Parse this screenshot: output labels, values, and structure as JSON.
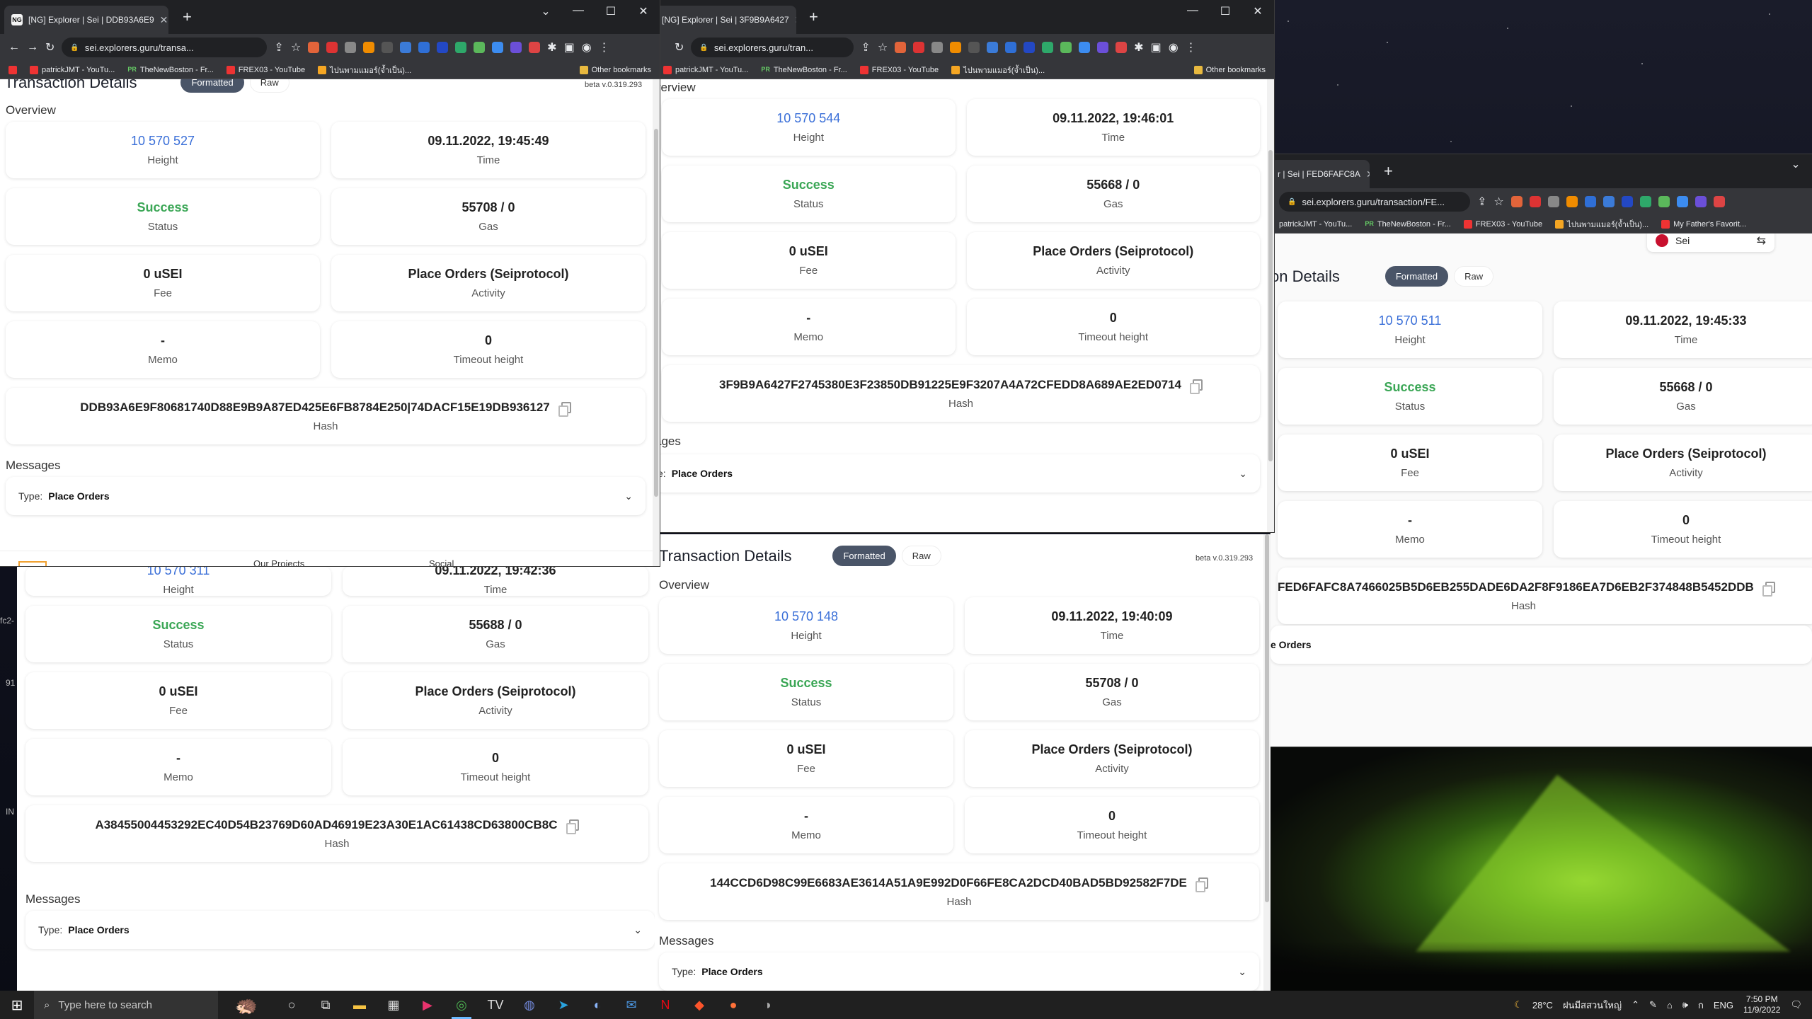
{
  "desktop": {
    "side_fragments": [
      "fc2-",
      "91",
      "IN"
    ]
  },
  "labels": {
    "height": "Height",
    "time": "Time",
    "status": "Status",
    "gas": "Gas",
    "fee": "Fee",
    "activity": "Activity",
    "memo": "Memo",
    "timeout": "Timeout height",
    "hash": "Hash",
    "overview": "Overview",
    "messages": "Messages",
    "type_prefix": "Type:",
    "formatted": "Formatted",
    "raw": "Raw",
    "page_title": "Transaction Details",
    "beta": "beta v.0.319.293",
    "new_tab": "+"
  },
  "win1": {
    "tab_title": "[NG] Explorer | Sei | DDB93A6E9",
    "url": "sei.explorers.guru/transa...",
    "bookmarks": [
      "patrickJMT - YouTu...",
      "TheNewBoston - Fr...",
      "FREX03 - YouTube",
      "ไปนพามแมอร์(จ้ำเป็น)...",
      "Other bookmarks"
    ],
    "height": "10 570 527",
    "time": "09.11.2022, 19:45:49",
    "status": "Success",
    "gas": "55708 / 0",
    "fee": "0 uSEI",
    "activity": "Place Orders (Seiprotocol)",
    "memo": "-",
    "timeout": "0",
    "hash": "DDB93A6E9F80681740D88E9B9A87ED425E6FB8784E250|74DACF15E19DB936127",
    "message_type": "Place Orders",
    "footer_frag": [
      "Our Projects",
      "Social"
    ]
  },
  "win2": {
    "tab_title": "[NG] Explorer | Sei | 3F9B9A6427",
    "url": "sei.explorers.guru/tran...",
    "bookmarks": [
      "patrickJMT - YouTu...",
      "TheNewBoston - Fr...",
      "FREX03 - YouTube",
      "ไปนพามแมอร์(จ้ำเป็น)...",
      "Other bookmarks"
    ],
    "overview_frag": "verview",
    "messages_frag": "ages",
    "type_frag": "e:",
    "height": "10 570 544",
    "time": "09.11.2022, 19:46:01",
    "status": "Success",
    "gas": "55668 / 0",
    "fee": "0 uSEI",
    "activity": "Place Orders (Seiprotocol)",
    "memo": "-",
    "timeout": "0",
    "hash": "3F9B9A6427F2745380E3F23850DB91225E9F3207A4A72CFEDD8A689AE2ED0714",
    "message_type": "Place Orders"
  },
  "win3": {
    "tab_title": "r | Sei | FED6FAFC8A",
    "url": "sei.explorers.guru/transaction/FE...",
    "bookmarks": [
      "patrickJMT - YouTu...",
      "TheNewBoston - Fr...",
      "FREX03 - YouTube",
      "ไปนพามแมอร์(จ้ำเป็น)...",
      "My Father's Favorit..."
    ],
    "chain": "Sei",
    "title_frag": "on Details",
    "height": "10 570 511",
    "time": "09.11.2022, 19:45:33",
    "status": "Success",
    "gas": "55668 / 0",
    "fee": "0 uSEI",
    "activity": "Place Orders (Seiprotocol)",
    "memo": "-",
    "timeout": "0",
    "hash": "FED6FAFC8A7466025B5D6EB255DADE6DA2F8F9186EA7D6EB2F374848B5452DDB",
    "message_frag": "e Orders"
  },
  "win4": {
    "height": "10 570 311",
    "time": "09.11.2022, 19:42:36",
    "status": "Success",
    "gas": "55688 / 0",
    "fee": "0 uSEI",
    "activity": "Place Orders (Seiprotocol)",
    "memo": "-",
    "timeout": "0",
    "hash": "A38455004453292EC40D54B23769D60AD46919E23A30E1AC61438CD63800CB8C",
    "message_type": "Place Orders"
  },
  "win5": {
    "height": "10 570 148",
    "time": "09.11.2022, 19:40:09",
    "status": "Success",
    "gas": "55708 / 0",
    "fee": "0 uSEI",
    "activity": "Place Orders (Seiprotocol)",
    "memo": "-",
    "timeout": "0",
    "hash": "144CCD6D98C99E6683AE3614A51A9E992D0F66FE8CA2DCD40BAD5BD92582F7DE",
    "message_type": "Place Orders"
  },
  "taskbar": {
    "search_placeholder": "Type here to search",
    "weather": "28°C",
    "weather_desc": "ฝนมีสสวนใหญ่",
    "lang": "ENG",
    "time": "7:50 PM",
    "date": "11/9/2022"
  }
}
